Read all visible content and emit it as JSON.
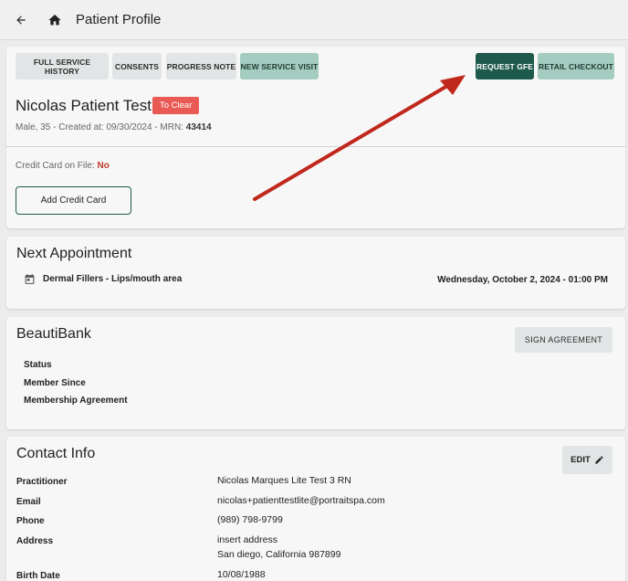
{
  "header": {
    "title": "Patient Profile"
  },
  "toolbar": {
    "full_history": "FULL SERVICE HISTORY",
    "consents": "CONSENTS",
    "progress_note": "PROGRESS NOTE",
    "new_visit": "NEW SERVICE VISIT",
    "request_gfe": "REQUEST GFE",
    "retail_checkout": "RETAIL CHECKOUT"
  },
  "patient": {
    "name": "Nicolas Patient Test",
    "badge": "To Clear",
    "meta_prefix": "Male, 35 - Created at: 09/30/2024 - MRN: ",
    "mrn": "43414",
    "credit_card_label": "Credit Card on File: ",
    "credit_card_value": "No",
    "add_credit_card": "Add Credit Card"
  },
  "appointment": {
    "title": "Next Appointment",
    "service": "Dermal Fillers - Lips/mouth area",
    "date": "Wednesday, October 2, 2024 - 01:00 PM"
  },
  "beautibank": {
    "title": "BeautiBank",
    "sign_agreement": "SIGN AGREEMENT",
    "items": [
      "Status",
      "Member Since",
      "Membership Agreement"
    ]
  },
  "contact": {
    "title": "Contact Info",
    "edit": "EDIT",
    "practitioner_label": "Practitioner",
    "practitioner": "Nicolas Marques Lite Test 3 RN",
    "email_label": "Email",
    "email": "nicolas+patienttestlite@portraitspa.com",
    "phone_label": "Phone",
    "phone": "(989) 798-9799",
    "address_label": "Address",
    "address_line1": "insert address",
    "address_line2": "San diego, California 987899",
    "birth_label": "Birth Date",
    "birth_date": "10/08/1988"
  },
  "colors": {
    "accent_dark": "#1e5a4c",
    "accent_mint": "#a5ccc0",
    "badge_red": "#e95a55",
    "annotation_arrow": "#c0281c"
  },
  "icons": {
    "back": "arrow-back-icon",
    "home": "home-icon",
    "calendar": "calendar-icon",
    "edit": "pencil-icon"
  }
}
